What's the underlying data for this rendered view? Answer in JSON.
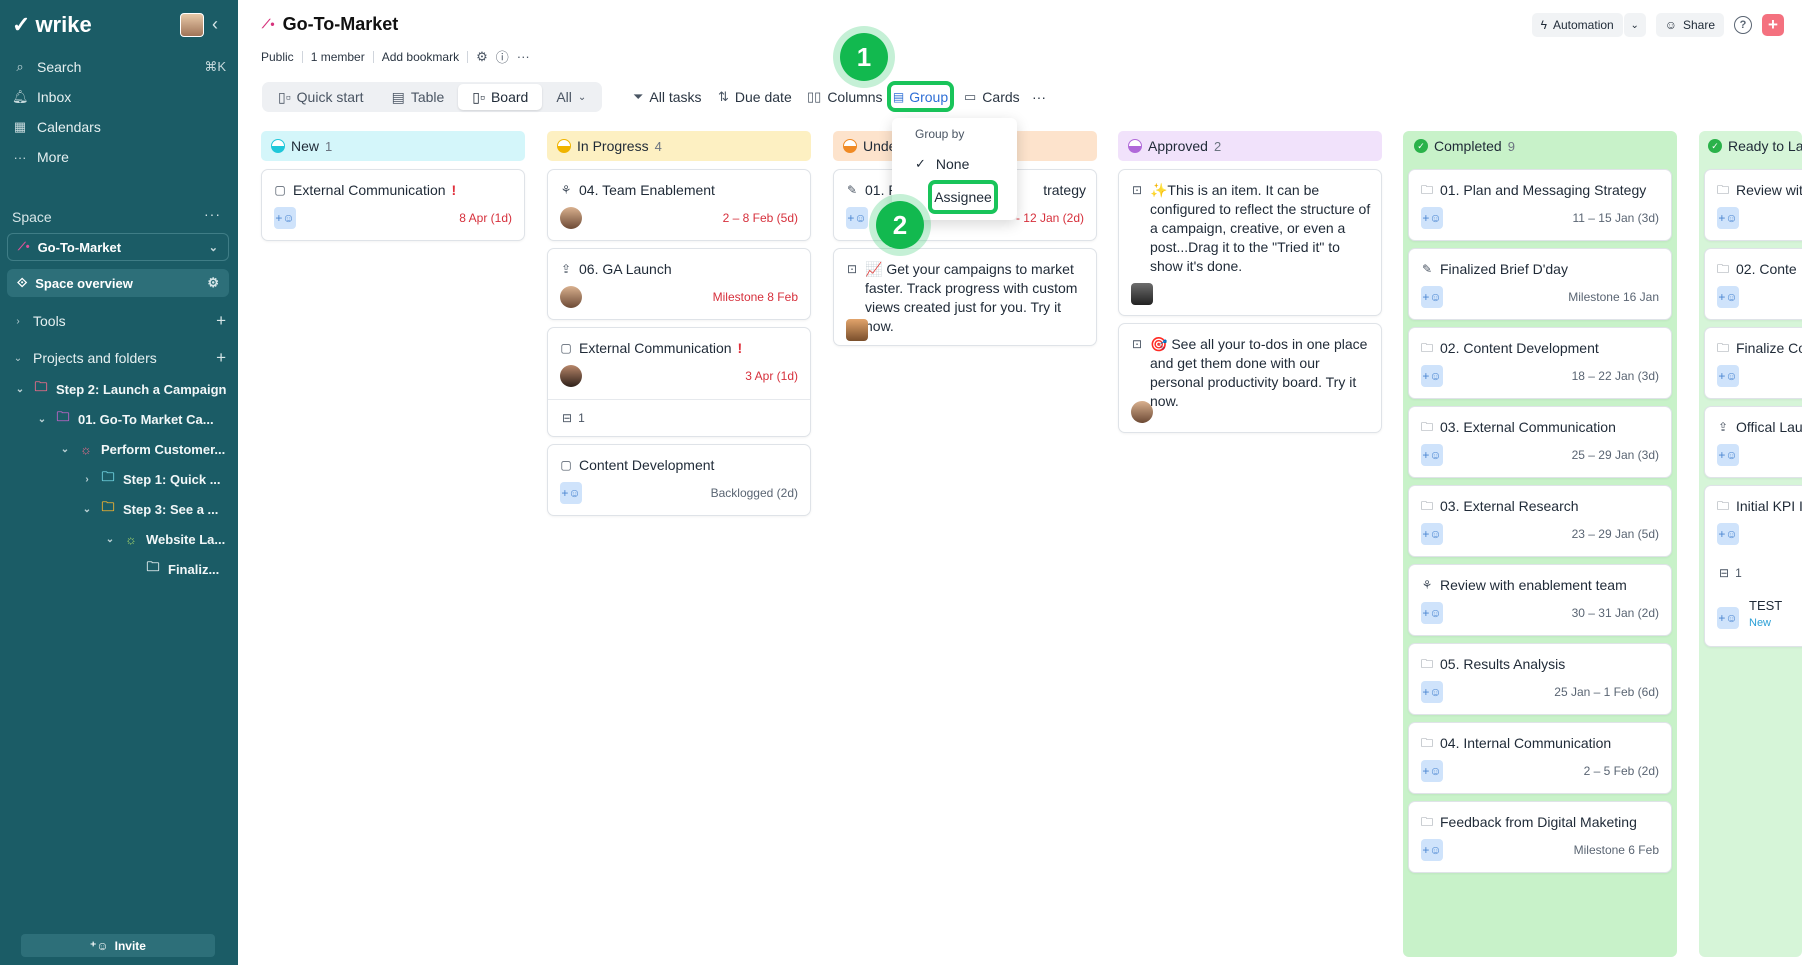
{
  "sidebar": {
    "logo": "wrike",
    "nav": [
      {
        "label": "Search",
        "icon": "search-icon",
        "shortcut": "⌘K"
      },
      {
        "label": "Inbox",
        "icon": "bell-icon",
        "shortcut": ""
      },
      {
        "label": "Calendars",
        "icon": "calendar-icon",
        "shortcut": ""
      },
      {
        "label": "More",
        "icon": "more-icon",
        "shortcut": ""
      }
    ],
    "space_label": "Space",
    "space_name": "Go-To-Market",
    "space_overview": "Space overview",
    "tools": "Tools",
    "projects": "Projects and folders",
    "tree": [
      {
        "label": "Step 2: Launch a Campaign"
      },
      {
        "label": "01. Go-To Market Ca..."
      },
      {
        "label": "Perform Customer..."
      },
      {
        "label": "Step 1: Quick ..."
      },
      {
        "label": "Step 3: See a ..."
      },
      {
        "label": "Website La..."
      },
      {
        "label": "Finaliz..."
      }
    ],
    "invite": "Invite"
  },
  "header": {
    "title": "Go-To-Market",
    "meta": [
      "Public",
      "1 member",
      "Add bookmark"
    ],
    "automation": "Automation",
    "share": "Share"
  },
  "toolbar": {
    "tabs": [
      "Quick start",
      "Table",
      "Board",
      "All"
    ],
    "items": [
      "All tasks",
      "Due date",
      "Columns",
      "Group",
      "Cards"
    ]
  },
  "dropdown": {
    "label": "Group by",
    "none": "None",
    "assignee": "Assignee"
  },
  "badges": [
    "1",
    "2"
  ],
  "columns": [
    {
      "name": "New",
      "count": "1",
      "color": "#1fc7d9",
      "bg": "#d4f6fa",
      "cards": [
        {
          "title": "External Communication",
          "urgent": "!",
          "date": "8 Apr (1d)"
        }
      ]
    },
    {
      "name": "In Progress",
      "count": "4",
      "color": "#f0b400",
      "bg": "#fdf0c2",
      "cards": [
        {
          "title": "04. Team Enablement",
          "date": "2 – 8 Feb (5d)"
        },
        {
          "title": "06. GA Launch",
          "date": "Milestone 8 Feb"
        },
        {
          "title": "External Communication",
          "urgent": "!",
          "date": "3 Apr (1d)",
          "sub": "1"
        },
        {
          "title": "Content Development",
          "date": "Backlogged (2d)"
        }
      ]
    },
    {
      "name": "Unde",
      "count": "",
      "color": "#f08a24",
      "bg": "#fde3cc",
      "cards": [
        {
          "title": "01. P",
          "title2": "trategy",
          "date": "- 12 Jan (2d)"
        },
        {
          "title": "📈 Get your campaigns to market faster. Track progress with custom views created just for you. Try it now."
        }
      ]
    },
    {
      "name": "Approved",
      "count": "2",
      "color": "#b069d9",
      "bg": "#f1e2fb",
      "cards": [
        {
          "title": "✨This is an item. It can be configured to reflect the structure of a campaign, creative, or even a post...Drag it to the \"Tried it\" to show it's done."
        },
        {
          "title": "🎯 See all your to-dos in one place and get them done with our personal productivity board. Try it now."
        }
      ]
    },
    {
      "name": "Completed",
      "count": "9",
      "color": "#2ab24a",
      "bg": "#c8f2c9",
      "cards": [
        {
          "title": "01. Plan and Messaging Strategy",
          "date": "11 – 15 Jan (3d)"
        },
        {
          "title": "Finalized Brief D'day",
          "date": "Milestone 16 Jan"
        },
        {
          "title": "02. Content Development",
          "date": "18 – 22 Jan (3d)"
        },
        {
          "title": "03. External Communication",
          "date": "25 – 29 Jan (3d)"
        },
        {
          "title": "03. External Research",
          "date": "23 – 29 Jan (5d)"
        },
        {
          "title": "Review with enablement team",
          "date": "30 – 31 Jan (2d)"
        },
        {
          "title": "05. Results Analysis",
          "date": "25 Jan – 1 Feb (6d)"
        },
        {
          "title": "04. Internal Communication",
          "date": "2 – 5 Feb (2d)"
        },
        {
          "title": "Feedback from Digital Maketing",
          "date": "Milestone 6 Feb"
        }
      ]
    },
    {
      "name": "Ready to La",
      "count": "",
      "color": "#2ab24a",
      "bg": "#d6f5d8",
      "cards": [
        {
          "title": "Review wit"
        },
        {
          "title": "02. Conte"
        },
        {
          "title": "Finalize Co"
        },
        {
          "title": "Offical Lau"
        },
        {
          "title": "Initial KPI I",
          "sub": "1",
          "sub_title": "TEST",
          "sub_status": "New"
        }
      ]
    }
  ]
}
